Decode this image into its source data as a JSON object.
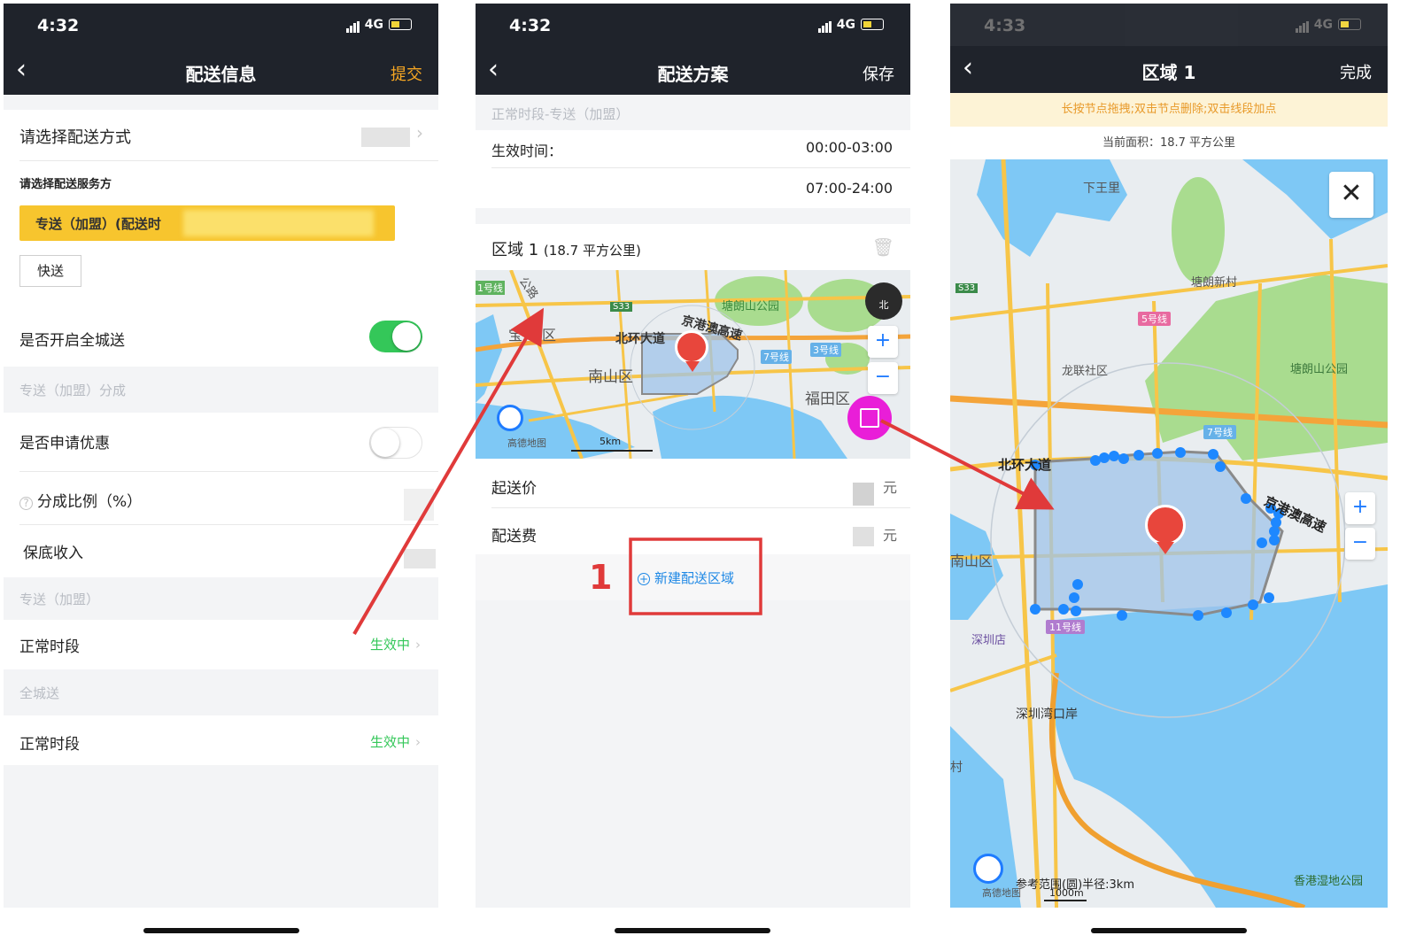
{
  "status_bar": {
    "time1": "4:32",
    "time2": "4:32",
    "time3": "4:33",
    "network": "4G"
  },
  "screen1": {
    "title": "配送信息",
    "action": "提交",
    "delivery_method_label": "请选择配送方式",
    "provider_label": "请选择配送服务方",
    "provider_selected": "专送（加盟）(配送时",
    "provider_option2": "快送",
    "citywide_toggle_label": "是否开启全城送",
    "citywide_toggle_on": true,
    "section_share": "专送（加盟）分成",
    "discount_label": "是否申请优惠",
    "discount_toggle_on": false,
    "ratio_label": "分成比例（%）",
    "min_income_label": "保底收入",
    "section_express": "专送（加盟）",
    "normal_period_1": "正常时段",
    "status_1": "生效中",
    "section_citywide": "全城送",
    "normal_period_2": "正常时段",
    "status_2": "生效中"
  },
  "screen2": {
    "title": "配送方案",
    "action": "保存",
    "section_header": "正常时段-专送（加盟）",
    "effective_time_label": "生效时间：",
    "time_range_1": "00:00-03:00",
    "time_range_2": "07:00-24:00",
    "area_title": "区域 1",
    "area_size": "(18.7 平方公里)",
    "map_labels": [
      "1号线",
      "公路",
      "宝",
      "区",
      "北环大道",
      "京港澳高速",
      "塘朗山公园",
      "南山区",
      "福田区",
      "7号线",
      "3号线",
      "S33",
      "高德地图",
      "5km",
      "北"
    ],
    "min_price_label": "起送价",
    "min_price_unit": "元",
    "delivery_fee_label": "配送费",
    "delivery_fee_unit": "元",
    "new_area_button": "新建配送区域",
    "annotation_number": "1"
  },
  "screen3": {
    "title": "区域 1",
    "action": "完成",
    "hint": "长按节点拖拽;双击节点删除;双击线段加点",
    "area_text": "当前面积：18.7 平方公里",
    "map_labels": [
      "下王里",
      "塘朗新村",
      "5号线",
      "龙联社区",
      "塘朗山公园",
      "北环大道",
      "7号线",
      "京港澳高速",
      "南山区",
      "深圳店",
      "11号线",
      "深圳湾口岸",
      "香港湿地公园",
      "S33",
      "村"
    ],
    "radius_text": "参考范围(圆)半径:3km",
    "scale_text": "1000m",
    "brand": "高德地图"
  },
  "colors": {
    "header_bg": "#1f232b",
    "submit_orange": "#f5a623",
    "toggle_green": "#34c759",
    "status_green": "#34c759",
    "provider_yellow": "#f7c52e",
    "link_blue": "#1e88e5",
    "annotation_red": "#e03a3a",
    "zone_fill": "#9fc3ea",
    "node_blue": "#1e88ff",
    "map_water": "#7ec8f5",
    "map_green": "#a9dc8f",
    "map_road": "#f7c548",
    "marker_red": "#e8463c",
    "magenta_button": "#e91ed8"
  }
}
